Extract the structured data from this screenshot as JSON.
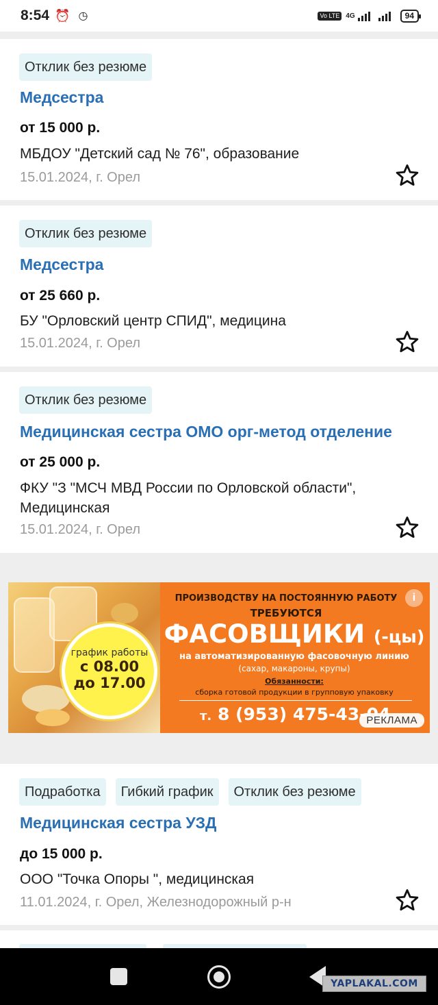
{
  "status_bar": {
    "time": "8:54",
    "network": "4G",
    "volte": "Vo LTE",
    "battery": "94"
  },
  "vacancies": [
    {
      "tags": [
        "Отклик без резюме"
      ],
      "title": "Медсестра",
      "salary": "от 15 000 р.",
      "company": "МБДОУ \"Детский сад № 76\", образование",
      "date_location": "15.01.2024, г. Орел"
    },
    {
      "tags": [
        "Отклик без резюме"
      ],
      "title": "Медсестра",
      "salary": "от 25 660 р.",
      "company": "БУ \"Орловский центр СПИД\", медицина",
      "date_location": "15.01.2024, г. Орел"
    },
    {
      "tags": [
        "Отклик без резюме"
      ],
      "title": "Медицинская сестра ОМО орг-метод отделение",
      "salary": "от 25 000 р.",
      "company": "ФКУ \"З \"МСЧ МВД России по Орловской области\", Медицинская",
      "date_location": "15.01.2024, г. Орел"
    },
    {
      "tags": [
        "Подработка",
        "Гибкий график",
        "Отклик без резюме"
      ],
      "title": "Медицинская сестра УЗД",
      "salary": "до 15 000 р.",
      "company": "ООО \"Точка Опоры \", медицинская",
      "date_location": "11.01.2024, г. Орел, Железнодорожный р-н"
    }
  ],
  "ad": {
    "line1": "ПРОИЗВОДСТВУ НА ПОСТОЯННУЮ РАБОТУ",
    "line2": "ТРЕБУЮТСЯ",
    "headline": "ФАСОВЩИКИ",
    "headline_suffix": "(-цы)",
    "line4": "на автоматизированную фасовочную линию",
    "line5": "(сахар, макароны, крупы)",
    "duties_label": "Обязанности:",
    "duties": "сборка готовой продукции в групповую упаковку",
    "phone_prefix": "т.",
    "phone": "8 (953) 475-43-04",
    "schedule_label": "график работы",
    "schedule_from": "с 08.00",
    "schedule_to": "до 17.00",
    "info": "i",
    "ad_label": "РЕКЛАМА"
  },
  "watermark": "YAPLAKAL.COM"
}
